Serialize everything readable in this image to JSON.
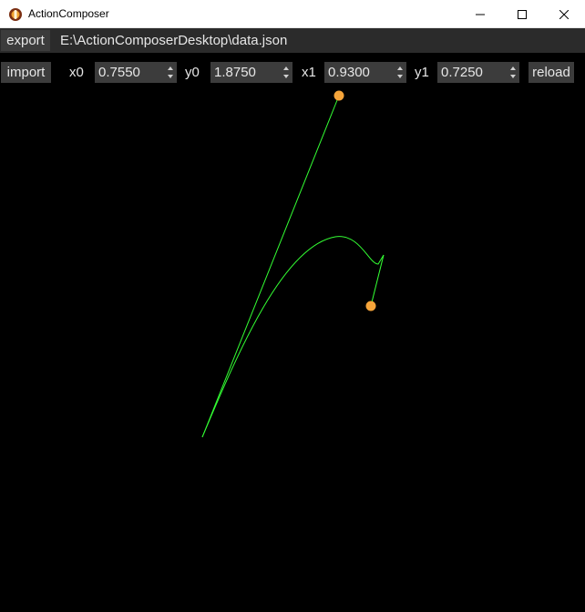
{
  "window": {
    "title": "ActionComposer"
  },
  "toolbar": {
    "export_label": "export",
    "path": "E:\\ActionComposerDesktop\\data.json",
    "import_label": "import",
    "reload_label": "reload",
    "fields": {
      "x0": {
        "label": "x0",
        "value": "0.7550"
      },
      "y0": {
        "label": "y0",
        "value": "1.8750"
      },
      "x1": {
        "label": "x1",
        "value": "0.9300"
      },
      "y1": {
        "label": "y1",
        "value": "0.7250"
      }
    }
  },
  "colors": {
    "curve": "#33ff33",
    "handle": "#f5a43a",
    "background": "#000000",
    "panel": "#2b2b2b",
    "button": "#3c3c3c",
    "text": "#e6e6e6"
  }
}
